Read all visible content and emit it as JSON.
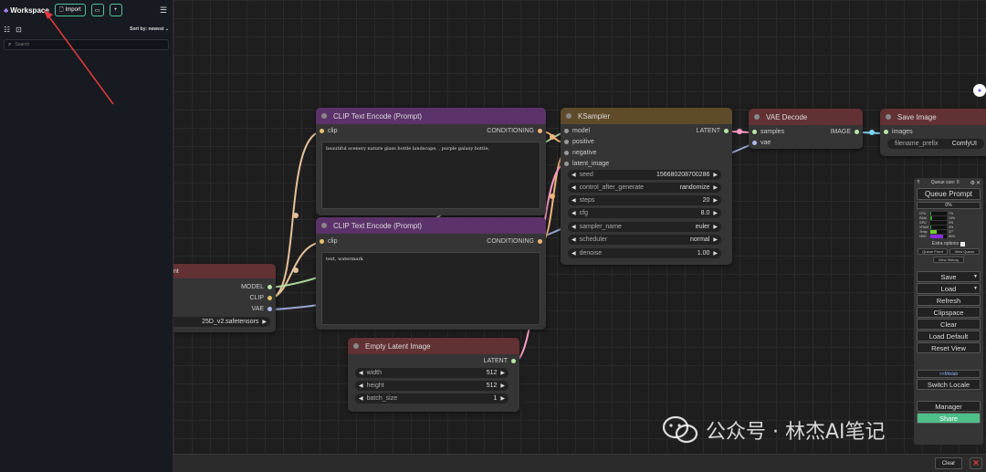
{
  "sidebar": {
    "title": "Workspace",
    "import_label": "Import",
    "sort_label": "Sort by:",
    "sort_value": "newest",
    "search_placeholder": "Search"
  },
  "nodes": {
    "clip_text_1": {
      "title": "CLIP Text Encode (Prompt)",
      "input_clip": "clip",
      "output": "CONDITIONING",
      "text": "beautiful scenery nature glass bottle landscape, , purple galaxy bottle,"
    },
    "clip_text_2": {
      "title": "CLIP Text Encode (Prompt)",
      "input_clip": "clip",
      "output": "CONDITIONING",
      "text": "text, watermark"
    },
    "ksampler": {
      "title": "KSampler",
      "inputs": [
        "model",
        "positive",
        "negative",
        "latent_image"
      ],
      "output": "LATENT",
      "widgets": [
        {
          "label": "seed",
          "value": "156680208700286"
        },
        {
          "label": "control_after_generate",
          "value": "randomize"
        },
        {
          "label": "steps",
          "value": "20"
        },
        {
          "label": "cfg",
          "value": "8.0"
        },
        {
          "label": "sampler_name",
          "value": "euler"
        },
        {
          "label": "scheduler",
          "value": "normal"
        },
        {
          "label": "denoise",
          "value": "1.00"
        }
      ]
    },
    "vae_decode": {
      "title": "VAE Decode",
      "inputs": [
        "samples",
        "vae"
      ],
      "output": "IMAGE"
    },
    "save_image": {
      "title": "Save Image",
      "input": "images",
      "widget_label": "filename_prefix",
      "widget_value": "ComfyUI"
    },
    "checkpoint": {
      "title_fragment": "nt",
      "outputs": [
        "MODEL",
        "CLIP",
        "VAE"
      ],
      "ckpt_value": "25D_v2.safetensors"
    },
    "empty_latent": {
      "title": "Empty Latent Image",
      "output": "LATENT",
      "widgets": [
        {
          "label": "width",
          "value": "512"
        },
        {
          "label": "height",
          "value": "512"
        },
        {
          "label": "batch_size",
          "value": "1"
        }
      ]
    }
  },
  "queue_panel": {
    "queue_size": "Queue size: 0",
    "queue_prompt": "Queue Prompt",
    "progress": "0%",
    "stats": [
      {
        "label": "CPU",
        "value": "7%",
        "fraction": 0.07,
        "color": "#2aa02a"
      },
      {
        "label": "RAM",
        "value": "10%",
        "fraction": 0.1,
        "color": "#2aa02a"
      },
      {
        "label": "GPU",
        "value": "0%",
        "fraction": 0.0,
        "color": "#2aa02a"
      },
      {
        "label": "VRAM",
        "value": "3%",
        "fraction": 0.03,
        "color": "#2aa02a"
      },
      {
        "label": "Temp",
        "value": "37°",
        "fraction": 0.37,
        "color": "#6fcf2a"
      },
      {
        "label": "HDD",
        "value": "80%",
        "fraction": 0.8,
        "color": "#8a2be2"
      }
    ],
    "extra_options": "Extra options",
    "queue_front": "Queue Front",
    "view_queue": "View Queue",
    "view_history": "View History",
    "buttons": [
      "Save",
      "Load",
      "Refresh",
      "Clipspace",
      "Clear",
      "Load Default",
      "Reset View"
    ],
    "mixlab": ">>Mixlab",
    "switch_locale": "Switch Locale",
    "manager": "Manager",
    "share": "Share"
  },
  "bottom_bar": {
    "clear": "Clear",
    "close": "✕"
  },
  "watermark": {
    "text": "公众号 · 林杰AI笔记"
  },
  "colors": {
    "accent": "#4cc39a",
    "clip_header": "#5b3269",
    "ksampler_header": "#5f4a2a",
    "vae_header": "#623133",
    "arrow": "#e03a3a"
  },
  "icons": [
    "workspace-logo-icon",
    "import-file-icon",
    "folder-icon",
    "plus-icon",
    "menu-icon",
    "list-icon",
    "new-folder-icon",
    "search-icon",
    "chevron-down-icon",
    "close-icon",
    "wechat-icon"
  ]
}
